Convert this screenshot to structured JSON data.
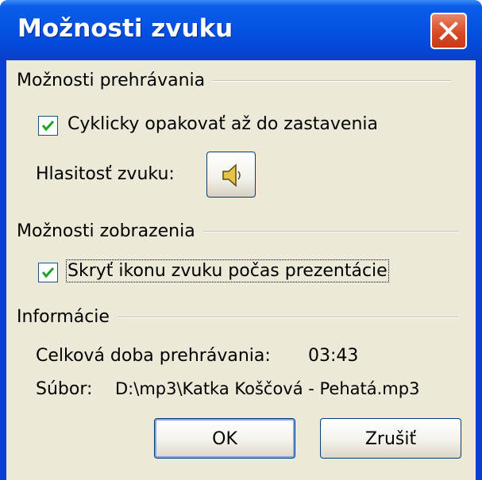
{
  "dialog": {
    "title": "Možnosti zvuku",
    "playback_group": {
      "heading": "Možnosti prehrávania",
      "loop_checkbox": {
        "label": "Cyklicky opakovať až do zastavenia",
        "checked": true
      },
      "volume_label": "Hlasitosť zvuku:",
      "volume_icon": "speaker-icon"
    },
    "display_group": {
      "heading": "Možnosti zobrazenia",
      "hide_icon_checkbox": {
        "label": "Skryť ikonu zvuku počas prezentácie",
        "checked": true
      }
    },
    "info_group": {
      "heading": "Informácie",
      "duration_label": "Celková doba prehrávania:",
      "duration_value": "03:43",
      "file_label": "Súbor:",
      "file_value": "D:\\mp3\\Katka Koščová - Pehatá.mp3"
    },
    "buttons": {
      "ok": "OK",
      "cancel": "Zrušiť"
    },
    "colors": {
      "title_bar": "#0655e6",
      "face": "#ece9d8",
      "close_button": "#d84a26",
      "check": "#21a121"
    }
  }
}
